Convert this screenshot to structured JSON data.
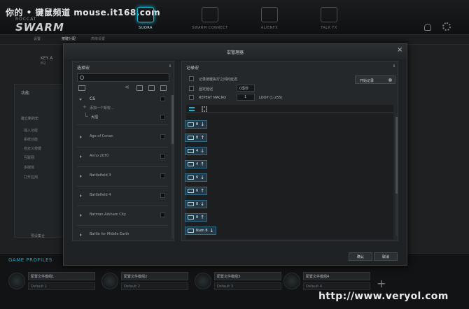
{
  "watermark_top": "你的 • 键鼠频道  mouse.it168.com",
  "watermark_bottom": "http://www.veryol.com",
  "app": {
    "brand_small": "ROCCAT",
    "brand": "SWARM"
  },
  "nav": {
    "tabs": [
      {
        "label": "SUORA",
        "icon": "keyboard-icon",
        "active": true
      },
      {
        "label": "SWARM CONNECT",
        "icon": "phone-icon",
        "active": false
      },
      {
        "label": "ALIENFX",
        "icon": "alien-icon",
        "active": false
      },
      {
        "label": "TALK FX",
        "icon": "triangle-icon",
        "active": false
      }
    ]
  },
  "subtabs": [
    "设置",
    "按键分配",
    "高级设置"
  ],
  "dialog": {
    "title": "宏管理器",
    "close": "×",
    "left_pane": {
      "header": "选择宏",
      "search_placeholder": "",
      "cs": {
        "name": "CS",
        "add_label": "添加一个新宏...",
        "child": "大招"
      },
      "items": [
        "Age of Conan",
        "Anno 2070",
        "Battlefield 3",
        "Battlefield 4",
        "Batman Arkham City",
        "Battle for Middle Earth"
      ]
    },
    "right_pane": {
      "header": "记录宏",
      "opt1": "记录按键执行之间的延迟",
      "opt2": "固定延迟",
      "opt2_value": "0毫秒",
      "opt3": "REPEAT MACRO",
      "opt3_value": "1",
      "opt3_hint": "LOOP (1-255)",
      "record_label": "开始记录",
      "events": [
        {
          "key": "B",
          "dir": "↓"
        },
        {
          "key": "B",
          "dir": "↑"
        },
        {
          "key": "4",
          "dir": "↓"
        },
        {
          "key": "4",
          "dir": "↑"
        },
        {
          "key": "6",
          "dir": "↓"
        },
        {
          "key": "6",
          "dir": "↑"
        },
        {
          "key": "8",
          "dir": "↓"
        },
        {
          "key": "8",
          "dir": "↑"
        },
        {
          "key": "Num 8",
          "dir": "↓"
        }
      ]
    },
    "ok": "确认",
    "cancel": "取消"
  },
  "background": {
    "panel_title": "功能",
    "items": [
      "建立新的宏",
      "插入功能",
      "系统功能",
      "自定义按键",
      "互联网",
      "多媒体",
      "打开应用"
    ],
    "bottom": "预设集合",
    "key_label": "KEY A",
    "key_sub": "M2"
  },
  "profiles": {
    "title": "GAME PROFILES",
    "slots": [
      {
        "name": "配置文件模组1",
        "default": "Default 1"
      },
      {
        "name": "配置文件模组2",
        "default": "Default 2"
      },
      {
        "name": "配置文件模组3",
        "default": "Default 3"
      },
      {
        "name": "配置文件模组4",
        "default": "Default 4"
      }
    ],
    "add": "+"
  }
}
